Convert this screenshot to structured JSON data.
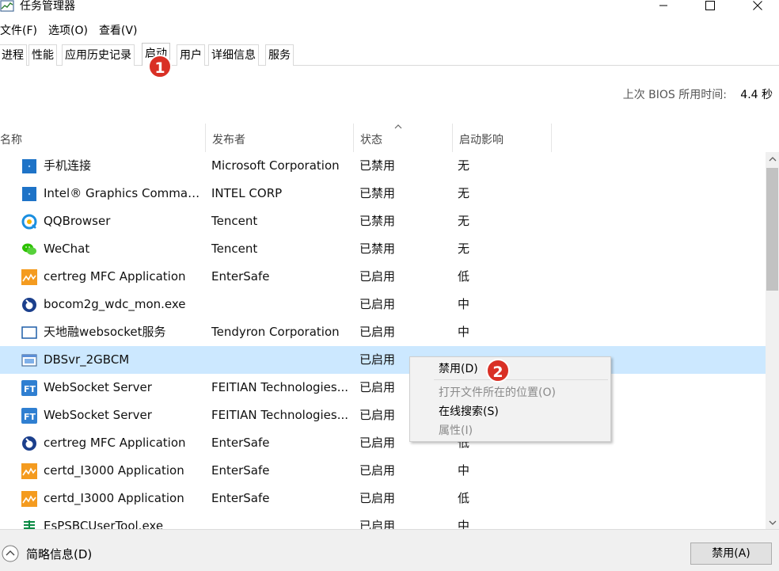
{
  "window": {
    "title": "任务管理器",
    "icon": "task-manager-icon"
  },
  "menu": [
    "文件(F)",
    "选项(O)",
    "查看(V)"
  ],
  "tabs": [
    "进程",
    "性能",
    "应用历史记录",
    "启动",
    "用户",
    "详细信息",
    "服务"
  ],
  "active_tab": "启动",
  "annotations": {
    "badge1": "1",
    "badge2": "2",
    "badge_color": "#d93025"
  },
  "bios": {
    "label": "上次 BIOS 所用时间:",
    "value": "4.4 秒"
  },
  "columns": {
    "name": "名称",
    "publisher": "发布者",
    "status": "状态",
    "impact": "启动影响"
  },
  "rows": [
    {
      "name": "手机连接",
      "publisher": "Microsoft Corporation",
      "status": "已禁用",
      "impact": "无",
      "icon": "blue-square-icon"
    },
    {
      "name": "Intel® Graphics Comman...",
      "publisher": "INTEL CORP",
      "status": "已禁用",
      "impact": "无",
      "icon": "blue-square-icon"
    },
    {
      "name": "QQBrowser",
      "publisher": "Tencent",
      "status": "已禁用",
      "impact": "无",
      "icon": "qqbrowser-icon"
    },
    {
      "name": "WeChat",
      "publisher": "Tencent",
      "status": "已禁用",
      "impact": "无",
      "icon": "wechat-icon"
    },
    {
      "name": "certreg MFC Application",
      "publisher": "EnterSafe",
      "status": "已启用",
      "impact": "低",
      "icon": "entersafe-icon"
    },
    {
      "name": "bocom2g_wdc_mon.exe",
      "publisher": "",
      "status": "已启用",
      "impact": "中",
      "icon": "bocom-icon"
    },
    {
      "name": "天地融websocket服务",
      "publisher": "Tendyron Corporation",
      "status": "已启用",
      "impact": "中",
      "icon": "window-outline-icon"
    },
    {
      "name": "DBSvr_2GBCM",
      "publisher": "",
      "status": "已启用",
      "impact": "",
      "icon": "app-window-icon",
      "selected": true
    },
    {
      "name": "WebSocket Server",
      "publisher": "FEITIAN Technologies...",
      "status": "已启用",
      "impact": "",
      "icon": "feitian-icon"
    },
    {
      "name": "WebSocket Server",
      "publisher": "FEITIAN Technologies...",
      "status": "已启用",
      "impact": "",
      "icon": "feitian-icon"
    },
    {
      "name": "certreg MFC Application",
      "publisher": "EnterSafe",
      "status": "已启用",
      "impact": "低",
      "icon": "bocom-icon"
    },
    {
      "name": "certd_I3000 Application",
      "publisher": "EnterSafe",
      "status": "已启用",
      "impact": "中",
      "icon": "entersafe-icon"
    },
    {
      "name": "certd_I3000 Application",
      "publisher": "EnterSafe",
      "status": "已启用",
      "impact": "低",
      "icon": "entersafe-icon"
    },
    {
      "name": "EsPSBCUserTool.exe",
      "publisher": "",
      "status": "已启用",
      "impact": "中",
      "icon": "psbc-icon"
    }
  ],
  "context_menu": {
    "disable": "禁用(D)",
    "open_location": "打开文件所在的位置(O)",
    "search_online": "在线搜索(S)",
    "properties": "属性(I)"
  },
  "footer": {
    "brief": "简略信息(D)",
    "disable_button": "禁用(A)"
  },
  "colors": {
    "selected_row": "#cce8ff",
    "accent": "#0078d7"
  }
}
